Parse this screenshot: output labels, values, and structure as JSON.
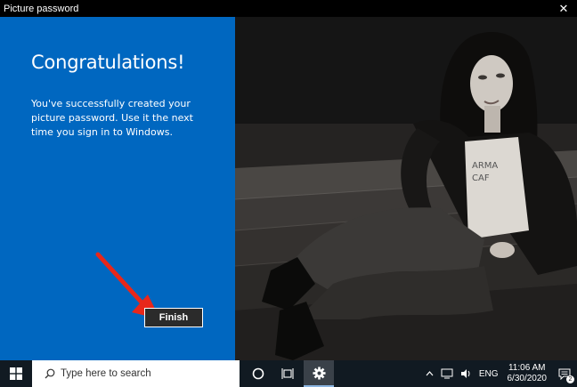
{
  "window": {
    "title": "Picture password",
    "close_glyph": "✕"
  },
  "panel": {
    "heading": "Congratulations!",
    "message": "You've successfully created your picture password. Use it the next time you sign in to Windows.",
    "finish_label": "Finish",
    "background_color": "#0067c0"
  },
  "photo": {
    "print_text_1": "ARMA",
    "print_text_2": "CAF"
  },
  "taskbar": {
    "search_placeholder": "Type here to search",
    "language": "ENG",
    "time": "11:06 AM",
    "date": "6/30/2020",
    "notification_count": "2",
    "icons": [
      "windows-logo-icon",
      "search-icon",
      "cortana-icon",
      "task-view-icon",
      "settings-icon",
      "chevron-up-icon",
      "network-icon",
      "volume-icon",
      "action-center-icon"
    ]
  },
  "annotation": {
    "arrow_color": "#e8271a"
  }
}
